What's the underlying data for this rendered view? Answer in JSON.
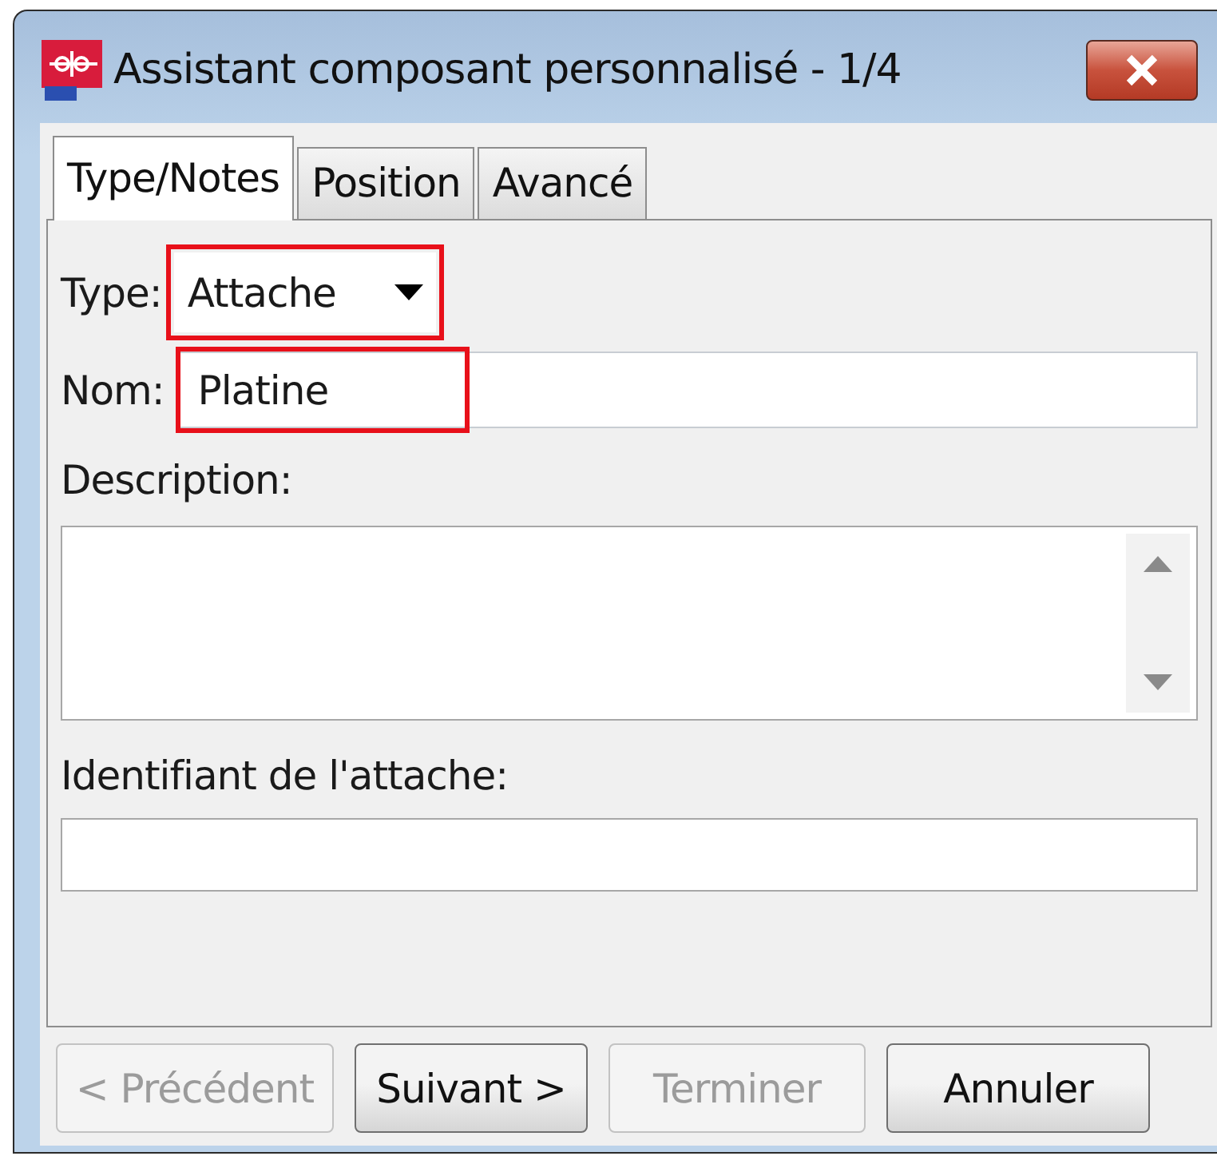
{
  "window": {
    "title": "Assistant composant personnalisé - 1/4"
  },
  "tabs": [
    {
      "label": "Type/Notes",
      "selected": true
    },
    {
      "label": "Position",
      "selected": false
    },
    {
      "label": "Avancé",
      "selected": false
    }
  ],
  "form": {
    "type": {
      "label": "Type:",
      "value": "Attache",
      "highlighted": true
    },
    "name": {
      "label": "Nom:",
      "value": "Platine",
      "highlighted": true
    },
    "description": {
      "label": "Description:"
    },
    "identifier": {
      "label": "Identifiant de l'attache:"
    }
  },
  "buttons": [
    {
      "label": "< Précédent",
      "disabled": true
    },
    {
      "label": "Suivant >",
      "disabled": false
    },
    {
      "label": "Terminer",
      "disabled": true
    },
    {
      "label": "Annuler",
      "disabled": false
    }
  ]
}
